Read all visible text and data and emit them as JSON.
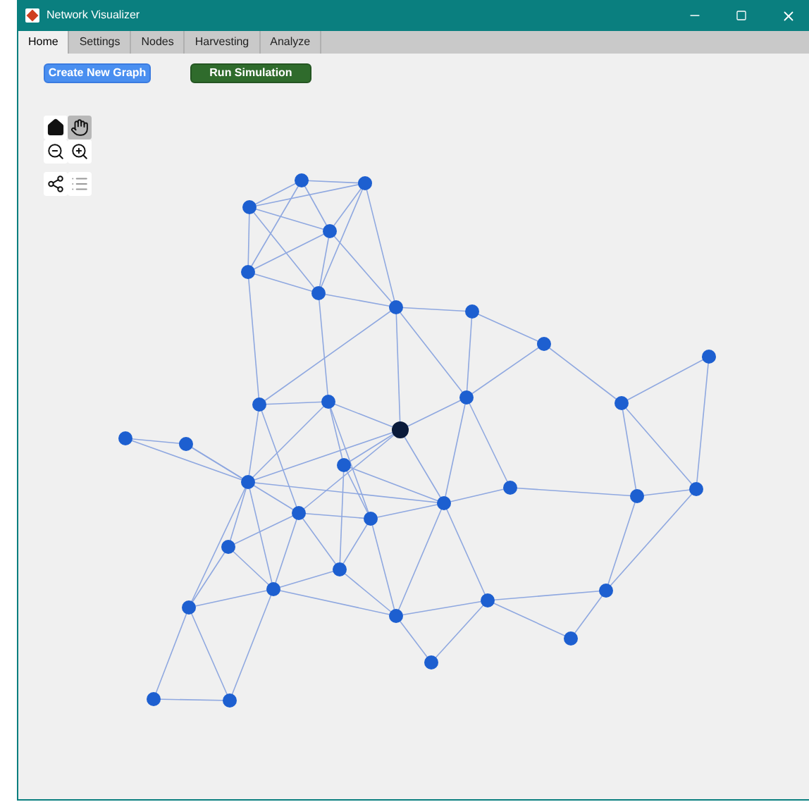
{
  "window": {
    "title": "Network Visualizer"
  },
  "tabs": [
    {
      "label": "Home",
      "selected": true
    },
    {
      "label": "Settings",
      "selected": false
    },
    {
      "label": "Nodes",
      "selected": false
    },
    {
      "label": "Harvesting",
      "selected": false
    },
    {
      "label": "Analyze",
      "selected": false
    }
  ],
  "buttons": [
    {
      "label": "Create New Graph",
      "kind": "primary"
    },
    {
      "label": "Run Simulation",
      "kind": "run"
    }
  ],
  "axes_toolbar": [
    {
      "kind": "home",
      "selected": false
    },
    {
      "kind": "pan",
      "selected": true
    },
    {
      "kind": "zoom-out",
      "selected": false
    },
    {
      "kind": "zoom-in",
      "selected": false
    },
    {
      "kind": "data-tips",
      "selected": false
    },
    {
      "kind": "legend",
      "selected": false
    }
  ]
}
